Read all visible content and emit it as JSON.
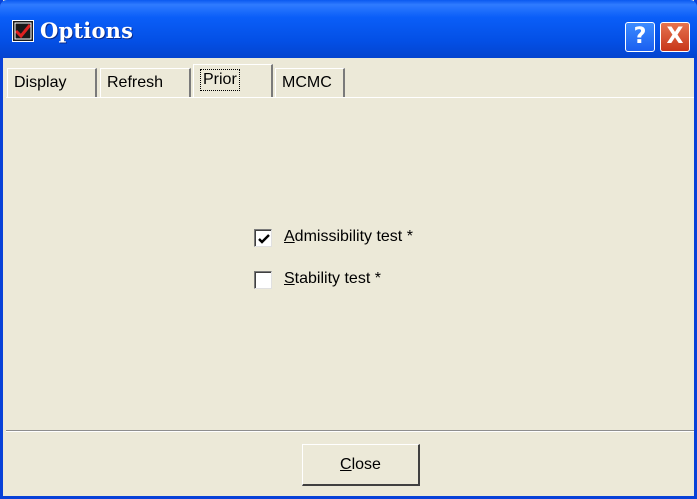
{
  "window": {
    "title": "Options"
  },
  "titlebar": {
    "help_glyph": "?",
    "close_glyph": "X"
  },
  "tabs": [
    {
      "label": "Display",
      "active": false
    },
    {
      "label": "Refresh",
      "active": false
    },
    {
      "label": "Prior",
      "active": true
    },
    {
      "label": "MCMC",
      "active": false
    }
  ],
  "options": [
    {
      "label_first": "A",
      "label_rest": "dmissibility test *",
      "checked": true
    },
    {
      "label_first": "S",
      "label_rest": "tability test *",
      "checked": false
    }
  ],
  "footer": {
    "close_first": "C",
    "close_rest": "lose"
  },
  "colors": {
    "titlebar": "#0a5ef8",
    "dialog_bg": "#ece9d8",
    "close_button": "#c7361a",
    "help_button": "#1a5ff0"
  }
}
